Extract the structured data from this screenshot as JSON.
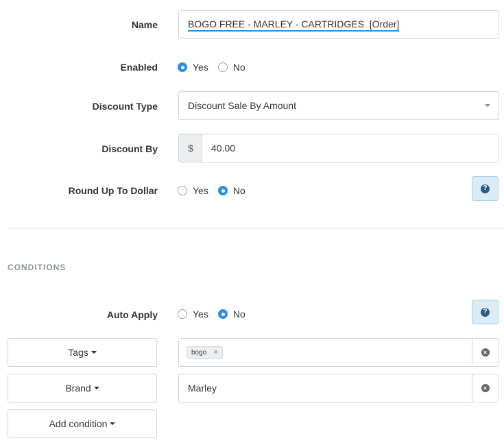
{
  "form": {
    "name": {
      "label": "Name",
      "value": "BOGO FREE - MARLEY - CARTRIDGES  [Order]"
    },
    "enabled": {
      "label": "Enabled",
      "options": [
        "Yes",
        "No"
      ],
      "selected": "Yes"
    },
    "discount_type": {
      "label": "Discount Type",
      "value": "Discount Sale By Amount"
    },
    "discount_by": {
      "label": "Discount By",
      "prefix": "$",
      "value": "40.00"
    },
    "round_up": {
      "label": "Round Up To Dollar",
      "options": [
        "Yes",
        "No"
      ],
      "selected": "No",
      "help": "?"
    }
  },
  "conditions": {
    "title": "CONDITIONS",
    "auto_apply": {
      "label": "Auto Apply",
      "options": [
        "Yes",
        "No"
      ],
      "selected": "No",
      "help": "?"
    },
    "rows": [
      {
        "button": "Tags",
        "tag": "bogo",
        "tag_remove": "×",
        "clear": "×"
      },
      {
        "button": "Brand",
        "value": "Marley",
        "clear": "×"
      }
    ],
    "add_button": "Add condition"
  },
  "colors": {
    "accent": "#2f8fe0",
    "help_bg": "#dcecf6"
  }
}
